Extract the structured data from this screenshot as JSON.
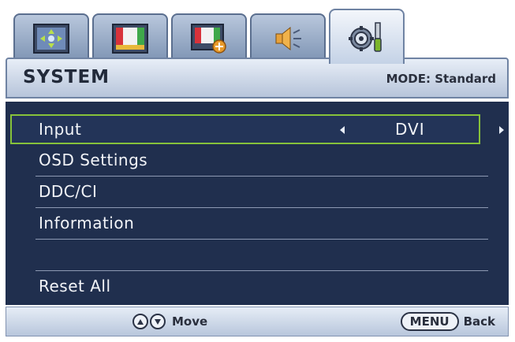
{
  "tabs": [
    {
      "name": "picture-position-icon"
    },
    {
      "name": "picture-icon"
    },
    {
      "name": "picture-advanced-icon"
    },
    {
      "name": "audio-icon"
    },
    {
      "name": "system-settings-icon",
      "active": true
    }
  ],
  "header": {
    "title": "SYSTEM",
    "mode": "MODE: Standard"
  },
  "menu": {
    "items": [
      {
        "label": "Input",
        "value": "DVI"
      },
      {
        "label": "OSD Settings"
      },
      {
        "label": "DDC/CI"
      },
      {
        "label": "Information"
      },
      {
        "label": ""
      },
      {
        "label": "Reset All"
      }
    ]
  },
  "footer": {
    "move_label": "Move",
    "menu_key": "MENU",
    "back_label": "Back"
  },
  "colors": {
    "menu_bg": "#202f4e",
    "highlight": "#86c23a"
  }
}
